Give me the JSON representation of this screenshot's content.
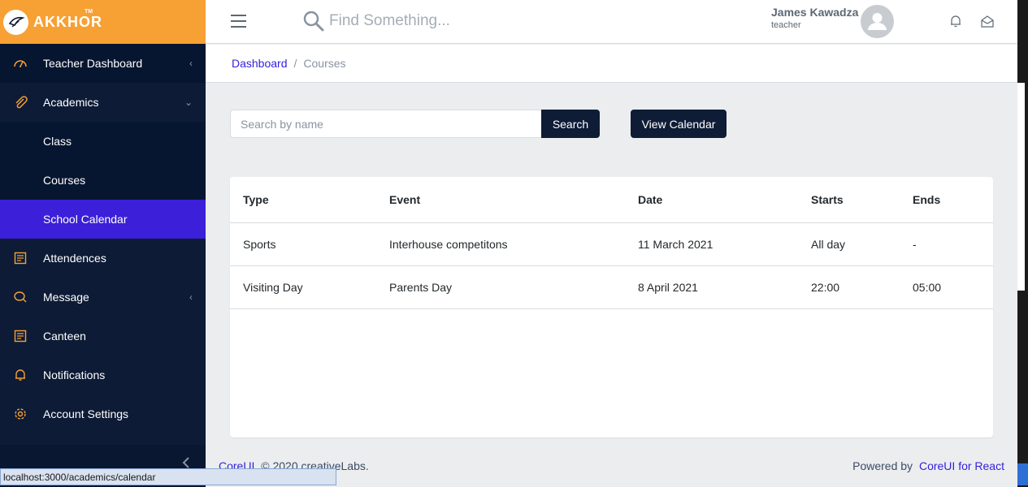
{
  "brand": {
    "name": "AKKHOR",
    "tm": "TM"
  },
  "sidebar": {
    "items": [
      {
        "label": "Teacher Dashboard",
        "icon": "speedometer-icon",
        "chevron": "‹"
      },
      {
        "label": "Academics",
        "icon": "paperclip-icon",
        "chevron": "⌄"
      },
      {
        "label": "Class"
      },
      {
        "label": "Courses"
      },
      {
        "label": "School Calendar"
      },
      {
        "label": "Attendences",
        "icon": "document-icon"
      },
      {
        "label": "Message",
        "icon": "chat-icon",
        "chevron": "‹"
      },
      {
        "label": "Canteen",
        "icon": "document-icon"
      },
      {
        "label": "Notifications",
        "icon": "bell-icon"
      },
      {
        "label": "Account Settings",
        "icon": "gear-icon"
      }
    ]
  },
  "header": {
    "search_placeholder": "Find Something...",
    "user_name": "James Kawadza",
    "user_role": "teacher"
  },
  "breadcrumb": {
    "root": "Dashboard",
    "separator": "/",
    "current": "Courses"
  },
  "main": {
    "search_placeholder": "Search by name",
    "search_button": "Search",
    "calendar_button": "View Calendar",
    "table": {
      "headers": [
        "Type",
        "Event",
        "Date",
        "Starts",
        "Ends"
      ],
      "rows": [
        [
          "Sports",
          "Interhouse competitons",
          "11 March 2021",
          "All day",
          "-"
        ],
        [
          "Visiting Day",
          "Parents Day",
          "8 April 2021",
          "22:00",
          "05:00"
        ]
      ]
    }
  },
  "footer": {
    "left_link": "CoreUI",
    "left_text": "© 2020 creativeLabs.",
    "right_text": "Powered by",
    "right_link": "CoreUI for React"
  },
  "status_bar": {
    "url": "localhost:3000/academics/calendar"
  },
  "colors": {
    "brand": "#f7a034",
    "sidebar": "#0d1b36",
    "active": "#3c1fd8",
    "link": "#321fdb",
    "icon": "#f7a034"
  }
}
